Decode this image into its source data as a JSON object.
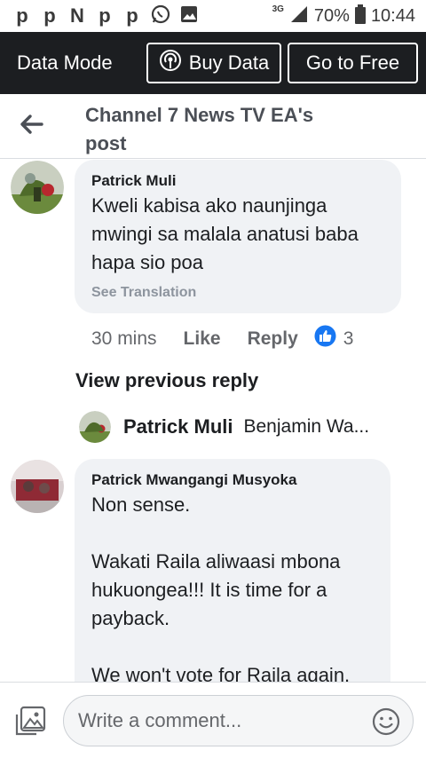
{
  "status_bar": {
    "notif_glyphs": [
      "p",
      "p",
      "N",
      "p",
      "p"
    ],
    "network": "3G",
    "battery": "70%",
    "time": "10:44"
  },
  "data_bar": {
    "mode_label": "Data Mode",
    "buy_label": "Buy Data",
    "free_label": "Go to Free"
  },
  "header": {
    "title": "Channel 7 News TV EA's post"
  },
  "comments": [
    {
      "author": "Patrick Muli",
      "text": "Kweli kabisa ako naunjinga mwingi sa malala anatusi baba hapa sio poa",
      "translation": "See Translation",
      "time": "30 mins",
      "like": "Like",
      "reply": "Reply",
      "reactions": "3"
    },
    {
      "author": "Patrick Mwangangi Musyoka",
      "text_lines": [
        "Non sense.",
        "",
        "Wakati Raila aliwaasi mbona hukuongea!!!  It is time for a payback.",
        "",
        "We won't vote for Raila again."
      ]
    }
  ],
  "view_previous": "View previous reply",
  "reply_preview": {
    "author": "Patrick Muli",
    "snippet": "Benjamin Wa..."
  },
  "composer": {
    "placeholder": "Write a comment..."
  },
  "colors": {
    "data_bar": "#1c1e21",
    "bubble": "#f0f2f5",
    "like_blue": "#1877f2",
    "muted": "#65676b"
  }
}
